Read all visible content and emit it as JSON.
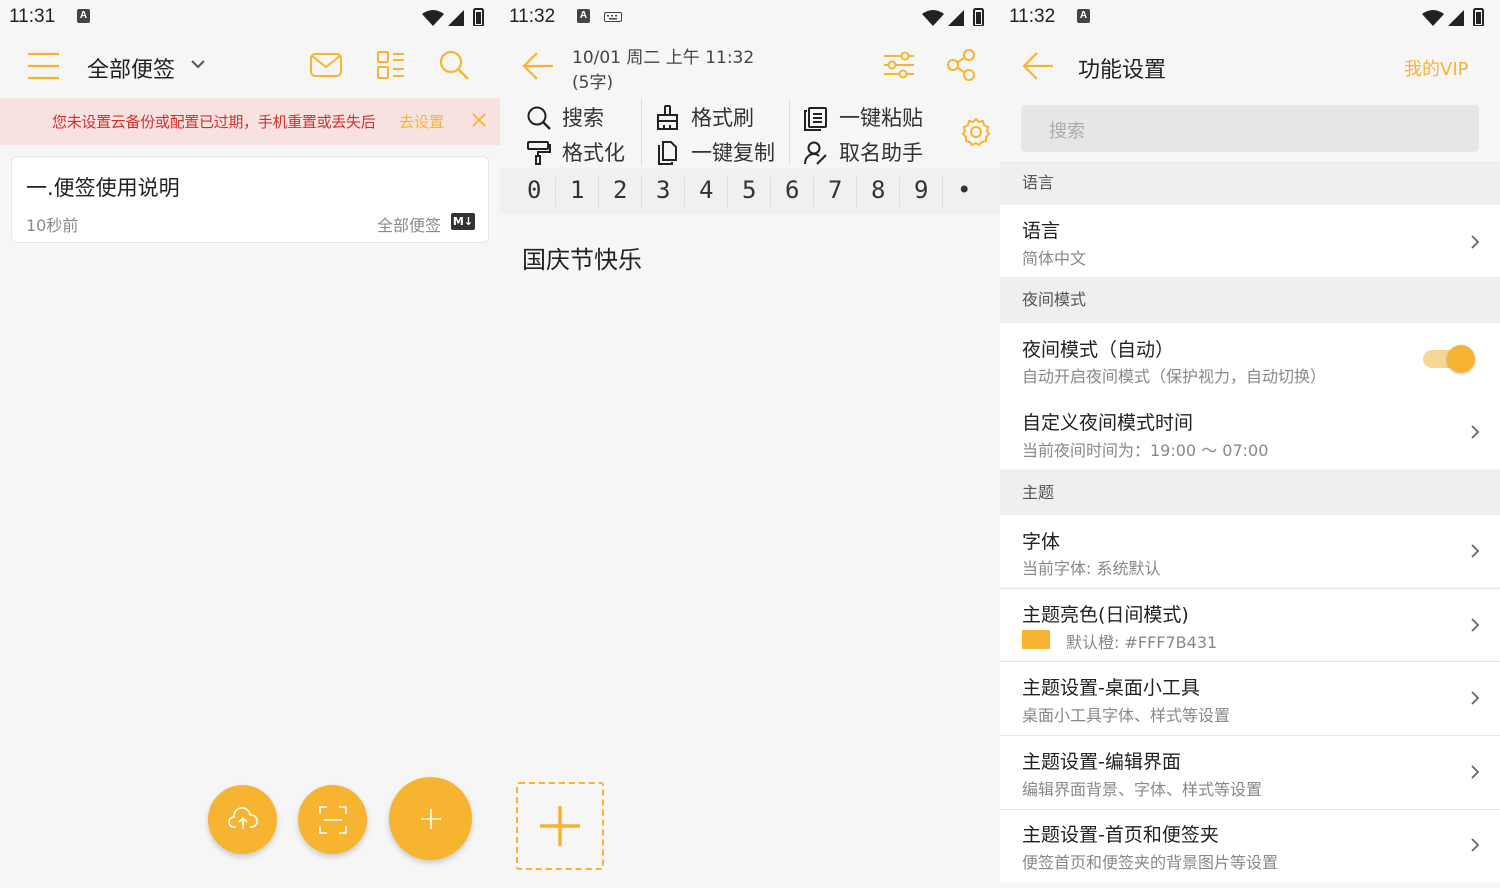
{
  "colors": {
    "accent": "#f7b431",
    "banner_bg": "#f8e2e0",
    "banner_text": "#d0312f"
  },
  "panel1": {
    "status": {
      "time": "11:31",
      "badge": "A"
    },
    "header": {
      "title": "全部便签"
    },
    "banner": {
      "message": "您未设置云备份或配置已过期，手机重置或丢失后",
      "action": "去设置"
    },
    "notes": [
      {
        "title": "一.便签使用说明",
        "time": "10秒前",
        "folder": "全部便签",
        "tag": "M↓"
      }
    ],
    "icons": [
      "menu-icon",
      "chevron-down-icon",
      "mail-icon",
      "grid-view-icon",
      "search-icon",
      "cloud-upload-icon",
      "scan-icon",
      "add-icon"
    ]
  },
  "panel2": {
    "status": {
      "time": "11:32",
      "badge": "A"
    },
    "header": {
      "date": "10/01 周二 上午 11:32",
      "count": "(5字)"
    },
    "toolbar": {
      "search": "搜索",
      "brush": "格式刷",
      "paste": "一键粘贴",
      "format": "格式化",
      "copy": "一键复制",
      "naming": "取名助手"
    },
    "digits": [
      "0",
      "1",
      "2",
      "3",
      "4",
      "5",
      "6",
      "7",
      "8",
      "9",
      "•"
    ],
    "content": "国庆节快乐"
  },
  "panel3": {
    "status": {
      "time": "11:32",
      "badge": "A"
    },
    "header": {
      "title": "功能设置",
      "vip": "我的VIP"
    },
    "search_placeholder": "搜索",
    "sections": {
      "language": "语言",
      "night": "夜间模式",
      "theme": "主题"
    },
    "rows": {
      "language": {
        "title": "语言",
        "sub": "简体中文"
      },
      "night_auto": {
        "title": "夜间模式（自动）",
        "sub": "自动开启夜间模式（保护视力，自动切换）",
        "toggle_on": true
      },
      "night_time": {
        "title": "自定义夜间模式时间",
        "sub": "当前夜间时间为：19:00 ～ 07:00"
      },
      "font": {
        "title": "字体",
        "sub": "当前字体: 系统默认"
      },
      "theme_color": {
        "title": "主题亮色(日间模式)",
        "sub": "默认橙: #FFF7B431",
        "swatch": "#f7b431"
      },
      "theme_widget": {
        "title": "主题设置-桌面小工具",
        "sub": "桌面小工具字体、样式等设置"
      },
      "theme_editor": {
        "title": "主题设置-编辑界面",
        "sub": "编辑界面背景、字体、样式等设置"
      },
      "theme_home": {
        "title": "主题设置-首页和便签夹",
        "sub": "便签首页和便签夹的背景图片等设置"
      }
    }
  }
}
